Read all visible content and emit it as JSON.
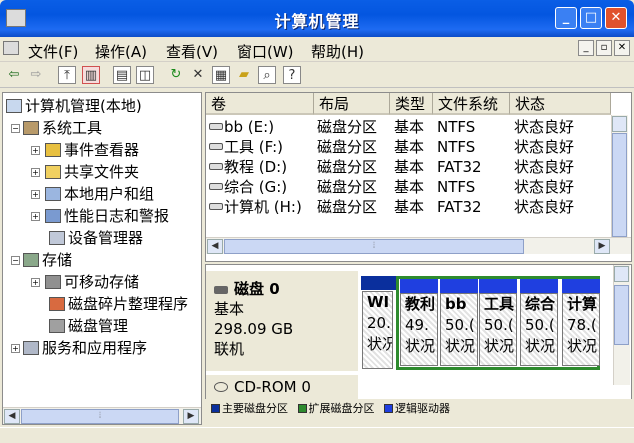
{
  "window": {
    "title": "计算机管理",
    "minimize": "_",
    "maximize": "□",
    "close": "✕"
  },
  "menu": {
    "items": [
      "文件(F)",
      "操作(A)",
      "查看(V)",
      "窗口(W)",
      "帮助(H)"
    ],
    "mdi_controls": [
      "_",
      "▫",
      "✕"
    ]
  },
  "toolbar": {
    "icons": [
      "back-icon",
      "forward-icon",
      "up-folder-icon",
      "show-tree-icon",
      "properties-icon",
      "show-pane-icon",
      "refresh-icon",
      "delete-icon",
      "properties2-icon",
      "open-folder-icon",
      "search-icon",
      "help-icon"
    ]
  },
  "tree": {
    "root": "计算机管理(本地)",
    "system_tools": "系统工具",
    "event_viewer": "事件查看器",
    "shared_folders": "共享文件夹",
    "local_users": "本地用户和组",
    "perf_logs": "性能日志和警报",
    "device_manager": "设备管理器",
    "storage": "存储",
    "removable": "可移动存储",
    "defrag": "磁盘碎片整理程序",
    "disk_mgmt": "磁盘管理",
    "services": "服务和应用程序"
  },
  "volumes": {
    "headers": [
      "卷",
      "布局",
      "类型",
      "文件系统",
      "状态"
    ],
    "rows": [
      {
        "vol": "bb (E:)",
        "layout": "磁盘分区",
        "type": "基本",
        "fs": "NTFS",
        "status": "状态良好"
      },
      {
        "vol": "工具 (F:)",
        "layout": "磁盘分区",
        "type": "基本",
        "fs": "NTFS",
        "status": "状态良好"
      },
      {
        "vol": "教程 (D:)",
        "layout": "磁盘分区",
        "type": "基本",
        "fs": "FAT32",
        "status": "状态良好"
      },
      {
        "vol": "综合 (G:)",
        "layout": "磁盘分区",
        "type": "基本",
        "fs": "NTFS",
        "status": "状态良好"
      },
      {
        "vol": "计算机 (H:)",
        "layout": "磁盘分区",
        "type": "基本",
        "fs": "FAT32",
        "status": "状态良好"
      }
    ]
  },
  "disk0": {
    "name": "磁盘 0",
    "type": "基本",
    "size": "298.09 GB",
    "state": "联机"
  },
  "partitions": [
    {
      "name": "WI",
      "size": "20.",
      "status": "状况"
    },
    {
      "name": "教利",
      "size": "49.",
      "status": "状况"
    },
    {
      "name": "bb",
      "size": "50.(",
      "status": "状况"
    },
    {
      "name": "工具",
      "size": "50.(",
      "status": "状况"
    },
    {
      "name": "综合",
      "size": "50.(",
      "status": "状况"
    },
    {
      "name": "计算",
      "size": "78.(",
      "status": "状况"
    }
  ],
  "cdrom": {
    "name": "CD-ROM 0"
  },
  "legend": [
    "主要磁盘分区",
    "扩展磁盘分区",
    "逻辑驱动器"
  ],
  "colors": {
    "primary": "#0a2f9d",
    "extended": "#2e8b2e",
    "logical": "#1f3fe0",
    "titlebar": "#0456e0"
  }
}
